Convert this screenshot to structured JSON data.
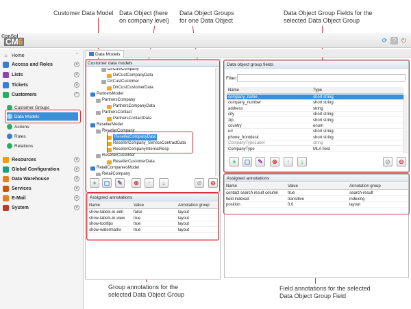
{
  "callouts": {
    "customer_data_model": "Customer Data Model",
    "data_object": "Data Object (here\non company level)",
    "data_object_groups": "Data Object Groups\nfor one Data Object",
    "group_fields": "Data Object Group Fields for the\nselected Data Object Group",
    "group_annotations": "Group annotations for the\nselected Data Object Group",
    "field_annotations": "Field annotations for the selected\nData Object Group Field"
  },
  "logo": {
    "line1": "ConSol",
    "line2_a": "CM",
    "line2_b": "6"
  },
  "sidebar": {
    "home": "Home",
    "sections": [
      {
        "label": "Access and Roles",
        "color": "#3a7bd5"
      },
      {
        "label": "Lists",
        "color": "#8e44ad"
      },
      {
        "label": "Tickets",
        "color": "#3a7bd5"
      },
      {
        "label": "Customers",
        "color": "#27ae60"
      }
    ],
    "customer_sub": [
      "Customer Groups",
      "Data Models",
      "Actions",
      "Roles",
      "Relations"
    ],
    "lower_sections": [
      {
        "label": "Resources",
        "color": "#f39c12"
      },
      {
        "label": "Global Configuration",
        "color": "#16a085"
      },
      {
        "label": "Data Warehouse",
        "color": "#e67e22"
      },
      {
        "label": "Services",
        "color": "#d35400"
      },
      {
        "label": "E-Mail",
        "color": "#e67e22"
      },
      {
        "label": "System",
        "color": "#c0392b"
      }
    ]
  },
  "tab": {
    "label": "Data Models"
  },
  "models_panel": {
    "title": "Customer data models",
    "tree": [
      "DirCustCompany",
      "DirCustCompanyData",
      "DirCustCustomer",
      "DirCustCustomerData",
      "PartnersModel",
      "PartnersCompany",
      "PartnersCompanyData",
      "PartnersContact",
      "PartnersContactData",
      "ResellerModel",
      "ResellerCompany",
      "ResellerCompanyData",
      "ResellerCompany_ServiceContractData",
      "ResellerCompanyInternalResp",
      "ResellerCustomer",
      "ResellerCustomerData",
      "RetailCompaniesModel",
      "RetailCompany"
    ]
  },
  "fields_panel": {
    "title": "Data object group fields",
    "filter_label": "Filter:",
    "columns": [
      "Name",
      "Type"
    ],
    "rows": [
      [
        "company_name",
        "short string"
      ],
      [
        "company_number",
        "short string"
      ],
      [
        "address",
        "string"
      ],
      [
        "city",
        "short string"
      ],
      [
        "zip",
        "short string"
      ],
      [
        "country",
        "enum"
      ],
      [
        "url",
        "short string"
      ],
      [
        "phone_frontdesk",
        "short string"
      ],
      [
        "CompanyTypeLabel",
        "string"
      ],
      [
        "CompanyType",
        "MLA field"
      ]
    ]
  },
  "group_annotations": {
    "title": "Assigned annotations",
    "columns": [
      "Name",
      "Value",
      "Annotation group"
    ],
    "rows": [
      [
        "show-labels-in-edit",
        "false",
        "layout"
      ],
      [
        "show-labels-in-view",
        "true",
        "layout"
      ],
      [
        "show-tooltips",
        "true",
        "layout"
      ],
      [
        "show-watermarks",
        "true",
        "layout"
      ]
    ]
  },
  "field_annotations": {
    "title": "Assigned annotations",
    "columns": [
      "Name",
      "Value",
      "Annotation group"
    ],
    "rows": [
      [
        "contact search result column",
        "true",
        "search-result"
      ],
      [
        "field indexed",
        "transitive",
        "indexing"
      ],
      [
        "position",
        "0;0",
        "layout"
      ]
    ]
  }
}
